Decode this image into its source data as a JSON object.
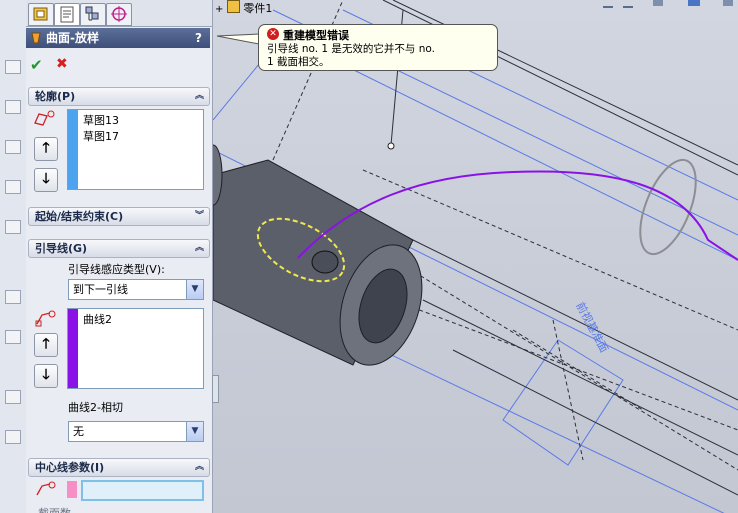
{
  "property_manager": {
    "title": "曲面-放样",
    "help": "?",
    "ok_symbol": "✔",
    "cancel_symbol": "✖",
    "profile": {
      "header": "轮廓(P)",
      "items": [
        "草图13",
        "草图17"
      ],
      "stripe_color": "#4ea3ee"
    },
    "start_end": {
      "header": "起始/结束约束(C)"
    },
    "guides": {
      "header": "引导线(G)",
      "influence_label": "引导线感应类型(V):",
      "influence_value": "到下一引线",
      "items": [
        "曲线2"
      ],
      "stripe_color": "#8a12e6",
      "tangency_label": "曲线2-相切",
      "tangency_value": "无"
    },
    "centerline": {
      "header": "中心线参数(I)",
      "stripe_color": "#f58fc6",
      "cut_label": "截面数"
    }
  },
  "viewport": {
    "tree_root": "零件1",
    "tooltip": {
      "title": "重建模型错误",
      "line1": "引导线 no. 1 是无效的它并不与 no.",
      "line2": "1 截面相交。"
    },
    "plane_label": "前视基准面"
  },
  "colors": {
    "guide_curve": "#8a12e6",
    "profile_ellipse": "#f2e84a",
    "sketch_lines": "#5a7ae6"
  }
}
